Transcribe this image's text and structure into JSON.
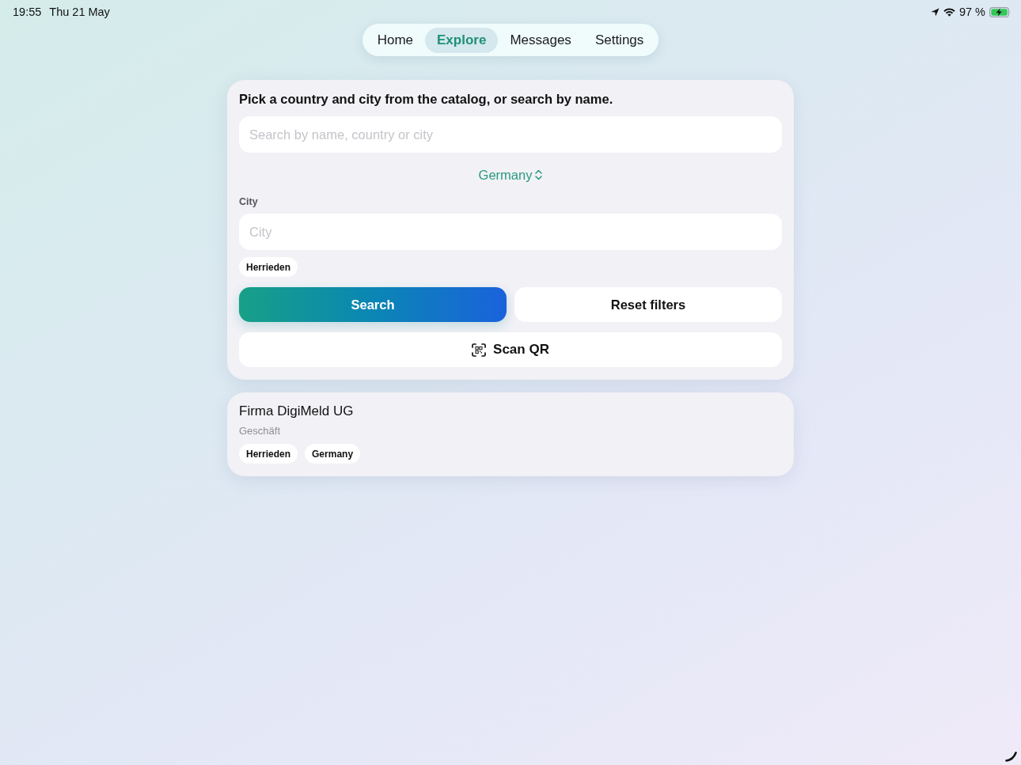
{
  "status_bar": {
    "time": "19:55",
    "date": "Thu 21 May",
    "battery_percent": "97 %",
    "charging": true
  },
  "tabs": [
    {
      "label": "Home",
      "selected": false
    },
    {
      "label": "Explore",
      "selected": true
    },
    {
      "label": "Messages",
      "selected": false
    },
    {
      "label": "Settings",
      "selected": false
    }
  ],
  "search_card": {
    "heading": "Pick a country and city from the catalog, or search by name.",
    "search_field": {
      "placeholder": "Search by name, country or city"
    },
    "country_picker": {
      "value": "Germany"
    },
    "city_field": {
      "label": "City",
      "placeholder": "City"
    },
    "city_chips": [
      "Herrieden"
    ],
    "buttons": [
      {
        "label": "Search",
        "kind": "primary"
      },
      {
        "label": "Reset filters",
        "kind": "secondary"
      },
      {
        "label": "Scan QR",
        "kind": "scan"
      }
    ]
  },
  "results": [
    {
      "name": "Firma DigiMeld UG",
      "category": "Geschäft",
      "tags": [
        "Herrieden",
        "Germany"
      ]
    }
  ]
}
